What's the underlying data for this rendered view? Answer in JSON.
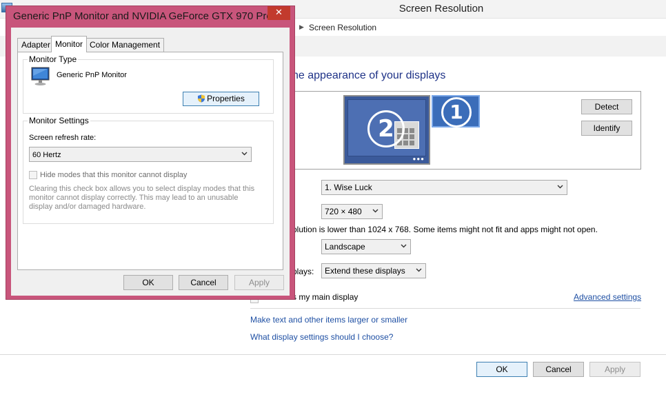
{
  "background_window": {
    "title": "Screen Resolution",
    "breadcrumb": "Screen Resolution",
    "heading": "ne appearance of your displays",
    "buttons": {
      "detect": "Detect",
      "identify": "Identify"
    },
    "monitor_numbers": {
      "primary": "1",
      "secondary": "2"
    },
    "display": {
      "selected": "1. Wise Luck"
    },
    "resolution": {
      "selected": "720 × 480"
    },
    "resolution_warning": "olution is lower than 1024 x 768. Some items might not fit and apps might not open.",
    "orientation": {
      "selected": "Landscape"
    },
    "multiple_displays": {
      "label": "plays:",
      "selected": "Extend these displays"
    },
    "main_display_label": "s my main display",
    "links": {
      "advanced": "Advanced settings",
      "text_size": "Make text and other items larger or smaller",
      "help": "What display settings should I choose?"
    },
    "footer": {
      "ok": "OK",
      "cancel": "Cancel",
      "apply": "Apply"
    }
  },
  "dialog": {
    "title": "Generic PnP Monitor and NVIDIA GeForce GTX 970 Pro...",
    "close_glyph": "✕",
    "tabs": [
      {
        "label": "Adapter",
        "active": false
      },
      {
        "label": "Monitor",
        "active": true
      },
      {
        "label": "Color Management",
        "active": false
      }
    ],
    "monitor_type": {
      "group_title": "Monitor Type",
      "name": "Generic PnP Monitor",
      "properties_button": "Properties"
    },
    "monitor_settings": {
      "group_title": "Monitor Settings",
      "refresh_label": "Screen refresh rate:",
      "refresh_value": "60 Hertz",
      "hide_modes_label": "Hide modes that this monitor cannot display",
      "hide_modes_checked": false,
      "note": "Clearing this check box allows you to select display modes that this monitor cannot display correctly. This may lead to an unusable display and/or damaged hardware."
    },
    "footer": {
      "ok": "OK",
      "cancel": "Cancel",
      "apply": "Apply"
    }
  },
  "colors": {
    "dialog_border": "#c8557b",
    "close_button": "#c23a2d",
    "heading": "#1e3287",
    "link": "#1e4fa3",
    "monitor_blue": "#4d6fb3"
  }
}
